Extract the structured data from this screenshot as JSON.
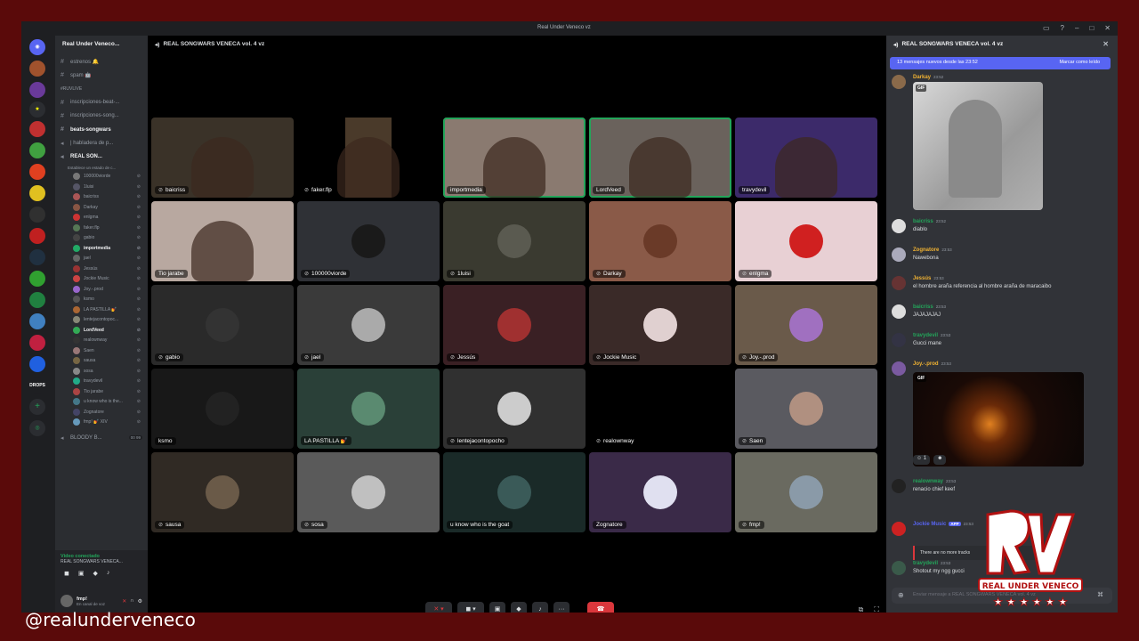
{
  "window": {
    "title": "Real Under Veneco vz"
  },
  "server": {
    "name": "Real Under Veneco..."
  },
  "channels": [
    {
      "label": "estrenos 🔔",
      "type": "text"
    },
    {
      "label": "spam 🤖",
      "type": "text"
    }
  ],
  "category": {
    "label": "#RUVLIVE"
  },
  "channels2": [
    {
      "label": "inscripciones-beat-...",
      "type": "text"
    },
    {
      "label": "inscripciones-song...",
      "type": "text"
    },
    {
      "label": "beats-songwars",
      "type": "text",
      "active": true
    },
    {
      "label": "| habladera de p...",
      "type": "voice"
    },
    {
      "label": "REAL SON...",
      "type": "voice",
      "active": true
    }
  ],
  "voice_status": "Establece un estado de c...",
  "voice_users": [
    "100000viorde",
    "1luisi",
    "baicriss",
    "Darkay",
    "enlgma",
    "faker.flp",
    "gabio",
    "importmedia",
    "jael",
    "Jessús",
    "Jockie Music",
    "Joy.-.prod",
    "ksmo",
    "LA PASTILLA 💅",
    "lentejacontopoc...",
    "LordVeed",
    "realownway",
    "Saen",
    "sausa",
    "sosa",
    "travydevil",
    "Tio jarabe",
    "u know who is the...",
    "Zognatore",
    "fmp! 💅 XIV"
  ],
  "voice_users_bold": [
    "importmedia",
    "LordVeed"
  ],
  "bloody": {
    "label": "BLOODY B...",
    "badge": "00 99"
  },
  "voice_panel": {
    "connected": "Video conectado",
    "channel": "REAL SONGWARS VENECA..."
  },
  "user_panel": {
    "name": "fmp!",
    "status": "En canal de voz"
  },
  "stage": {
    "title": "REAL SONGWARS VENECA vol. 4 vz"
  },
  "tiles": [
    {
      "name": "baicriss",
      "mic": true,
      "cam": true,
      "bg": "#3a3228"
    },
    {
      "name": "faker.flp",
      "mic": true,
      "cam": true,
      "bg": "#4a3a2a",
      "narrow": true
    },
    {
      "name": "importmedia",
      "mic": false,
      "cam": true,
      "bg": "#8a7a70",
      "speaking": true
    },
    {
      "name": "LordVeed",
      "mic": false,
      "cam": true,
      "bg": "#6a625c",
      "speaking": true
    },
    {
      "name": "travydevil",
      "mic": false,
      "cam": true,
      "bg": "#3c2a6a"
    },
    {
      "name": "Tio jarabe",
      "mic": false,
      "cam": true,
      "bg": "#b8a8a0"
    },
    {
      "name": "100000viorde",
      "mic": true,
      "cam": false,
      "bg": "#2f3136",
      "avatar": "#1a1a1a"
    },
    {
      "name": "1luisi",
      "mic": true,
      "cam": false,
      "bg": "#3a3a30",
      "avatar": "#5a5a50"
    },
    {
      "name": "Darkay",
      "mic": true,
      "cam": false,
      "bg": "#8a5a48",
      "avatar": "#6a3a28"
    },
    {
      "name": "enlgma",
      "mic": true,
      "cam": false,
      "bg": "#e8d0d4",
      "avatar": "#d02020"
    },
    {
      "name": "gabio",
      "mic": true,
      "cam": false,
      "bg": "#2a2a2a",
      "avatar": "#333333"
    },
    {
      "name": "jael",
      "mic": true,
      "cam": false,
      "bg": "#3a3a3a",
      "avatar": "#aaaaaa"
    },
    {
      "name": "Jessús",
      "mic": true,
      "cam": false,
      "bg": "#3a2024",
      "avatar": "#a03030"
    },
    {
      "name": "Jockie Music",
      "mic": true,
      "cam": false,
      "bg": "#3a2a28",
      "avatar": "#e0d0d0"
    },
    {
      "name": "Joy.-.prod",
      "mic": true,
      "cam": false,
      "bg": "#6a5a4a",
      "avatar": "#a070c0"
    },
    {
      "name": "ksmo",
      "mic": false,
      "cam": false,
      "bg": "#181818",
      "avatar": "#222222"
    },
    {
      "name": "LA PASTILLA 💅",
      "mic": false,
      "cam": false,
      "bg": "#2a4038",
      "avatar": "#5a8a70"
    },
    {
      "name": "lentejacontopocho",
      "mic": true,
      "cam": false,
      "bg": "#303030",
      "avatar": "#cccccc"
    },
    {
      "name": "realownway",
      "mic": true,
      "cam": false,
      "bg": "#000000",
      "avatar": "#000000"
    },
    {
      "name": "Saen",
      "mic": true,
      "cam": false,
      "bg": "#5a5a60",
      "avatar": "#b09080"
    },
    {
      "name": "sausa",
      "mic": true,
      "cam": false,
      "bg": "#302a24",
      "avatar": "#6a5a48"
    },
    {
      "name": "sosa",
      "mic": true,
      "cam": false,
      "bg": "#5a5a5a",
      "avatar": "#c0c0c0"
    },
    {
      "name": "u know who is the goat",
      "mic": false,
      "cam": false,
      "bg": "#1a2a28",
      "avatar": "#3a5a58"
    },
    {
      "name": "Zognatore",
      "mic": false,
      "cam": false,
      "bg": "#3a2a48",
      "avatar": "#e0e0f0"
    },
    {
      "name": "fmp!",
      "mic": true,
      "cam": false,
      "bg": "#6a6a60",
      "avatar": "#8a9aa8"
    }
  ],
  "chat": {
    "title": "REAL SONGWARS VENECA vol. 4 vz",
    "new_messages": "13 mensajes nuevos desde las 23:52",
    "mark_read": "Marcar como leído",
    "messages": [
      {
        "name": "Darkay",
        "time": "23:52",
        "text": "",
        "color": "#f0b232"
      },
      {
        "name": "baicriss",
        "time": "23:52",
        "text": "diablo",
        "color": "#23a55a"
      },
      {
        "name": "Zognatore",
        "time": "23:53",
        "text": "Nawebona",
        "color": "#f0b232"
      },
      {
        "name": "Jessús",
        "time": "23:53",
        "text": "el hombre araña referencia al hombre araña de maracaibo",
        "color": "#f0b232"
      },
      {
        "name": "baicriss",
        "time": "23:53",
        "text": "JAJAJAJAJ",
        "color": "#23a55a"
      },
      {
        "name": "travydevil",
        "time": "23:53",
        "text": "Gucci mane",
        "color": "#23a55a"
      },
      {
        "name": "Joy.-.prod",
        "time": "23:53",
        "text": "",
        "color": "#f0b232"
      },
      {
        "name": "realownway",
        "time": "23:53",
        "text": "renacio chief keef",
        "color": "#23a55a"
      },
      {
        "name": "Jockie Music",
        "time": "23:53",
        "text": "",
        "color": "#5865f2",
        "app": "APP"
      },
      {
        "name": "travydevil",
        "time": "23:53",
        "text": "Shotout my ngg gucci",
        "color": "#23a55a"
      }
    ],
    "gif_label": "GIF",
    "reaction": "1",
    "reply": "There are no more tracks",
    "composer_placeholder": "Enviar mensaje a REAL SONGWARS VENECA vol. 4 vz"
  },
  "watermark": "@realunderveneco",
  "logo_text": "REAL UNDER VENECO"
}
